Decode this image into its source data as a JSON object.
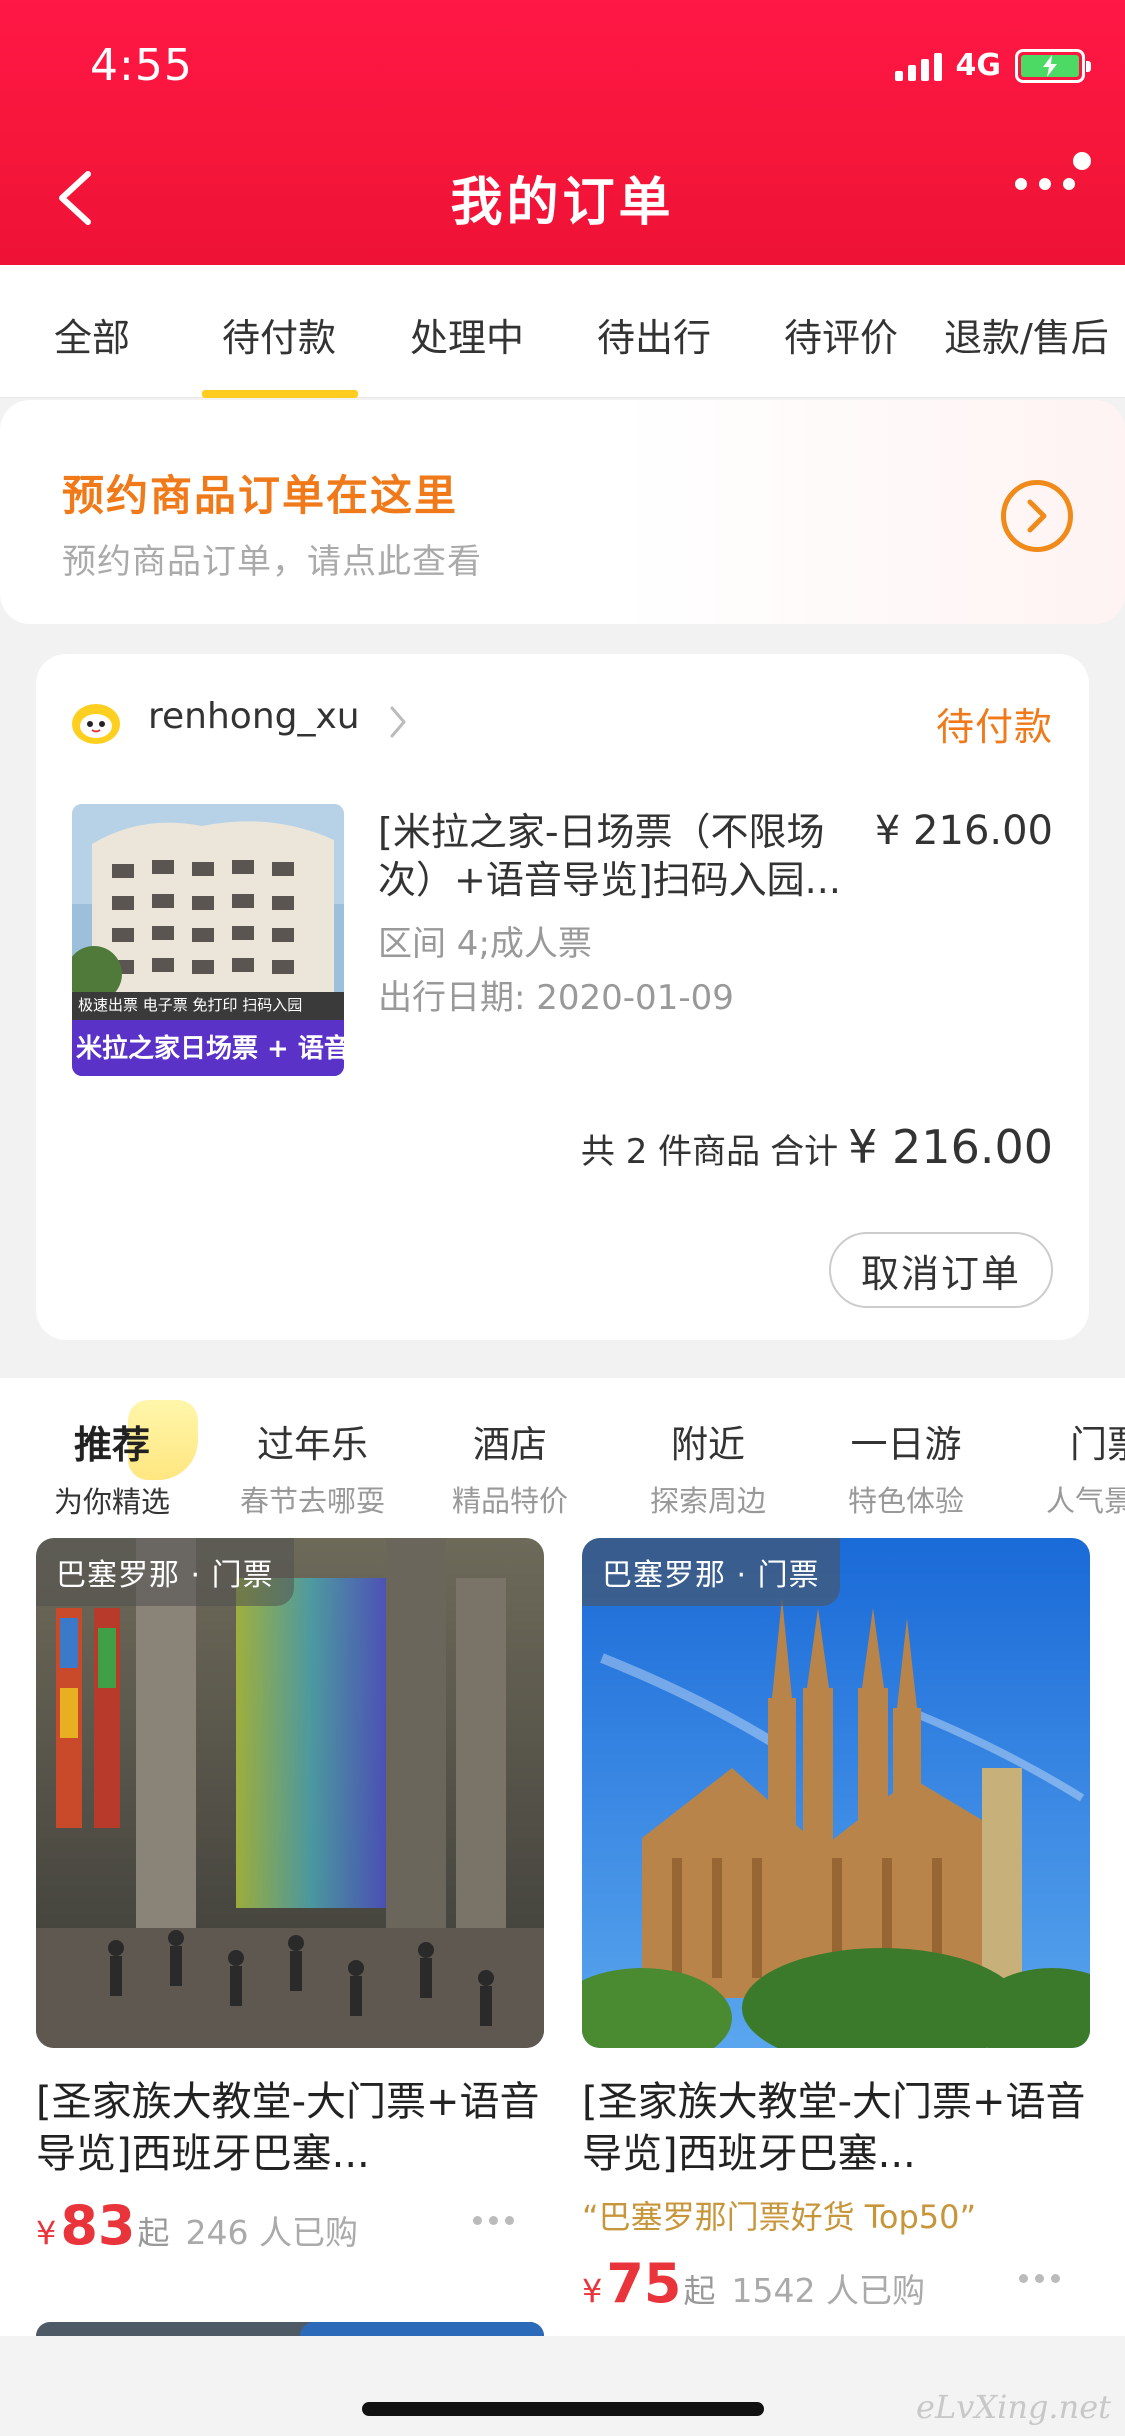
{
  "status_bar": {
    "time": "4:55",
    "network": "4G"
  },
  "header": {
    "title": "我的订单"
  },
  "order_tabs": [
    {
      "label": "全部"
    },
    {
      "label": "待付款"
    },
    {
      "label": "处理中"
    },
    {
      "label": "待出行"
    },
    {
      "label": "待评价"
    },
    {
      "label": "退款/售后"
    }
  ],
  "active_tab": "待付款",
  "booking_banner": {
    "title": "预约商品订单在这里",
    "subtitle": "预约商品订单，请点此查看"
  },
  "order": {
    "shop_name": "renhong_xu",
    "status": "待付款",
    "product_title": "[米拉之家-日场票（不限场次）+语音导览]扫码入园...",
    "product_price": "¥ 216.00",
    "product_spec": "区间 4;成人票",
    "travel_date": "出行日期: 2020-01-09",
    "thumb_text_top": "极速出票 电子票 免打印 扫码入园",
    "thumb_text_bottom": "米拉之家日场票 + 语音导览",
    "summary_count": "共 2 件商品",
    "summary_label": "合计",
    "total": "¥ 216.00",
    "cancel_label": "取消订单"
  },
  "recommend_tabs": [
    {
      "title": "推荐",
      "subtitle": "为你精选"
    },
    {
      "title": "过年乐",
      "subtitle": "春节去哪耍"
    },
    {
      "title": "酒店",
      "subtitle": "精品特价"
    },
    {
      "title": "附近",
      "subtitle": "探索周边"
    },
    {
      "title": "一日游",
      "subtitle": "特色体验"
    },
    {
      "title": "门票",
      "subtitle": "人气景"
    }
  ],
  "products": [
    {
      "tag": "巴塞罗那 · 门票",
      "title": "[圣家族大教堂-大门票+语音导览]西班牙巴塞...",
      "highlight": "",
      "currency": "¥",
      "price": "83",
      "price_suffix": "起",
      "sold": "246 人已购"
    },
    {
      "tag": "巴塞罗那 · 门票",
      "title": "[圣家族大教堂-大门票+语音导览]西班牙巴塞...",
      "highlight": "“巴塞罗那门票好货 Top50”",
      "currency": "¥",
      "price": "75",
      "price_suffix": "起",
      "sold": "1542 人已购"
    }
  ],
  "watermark": "eLvXing.net",
  "colors": {
    "header_red": "#f5163a",
    "accent_orange": "#f07a1a",
    "tab_underline": "#ffcc1f",
    "price_red": "#e8343a"
  }
}
